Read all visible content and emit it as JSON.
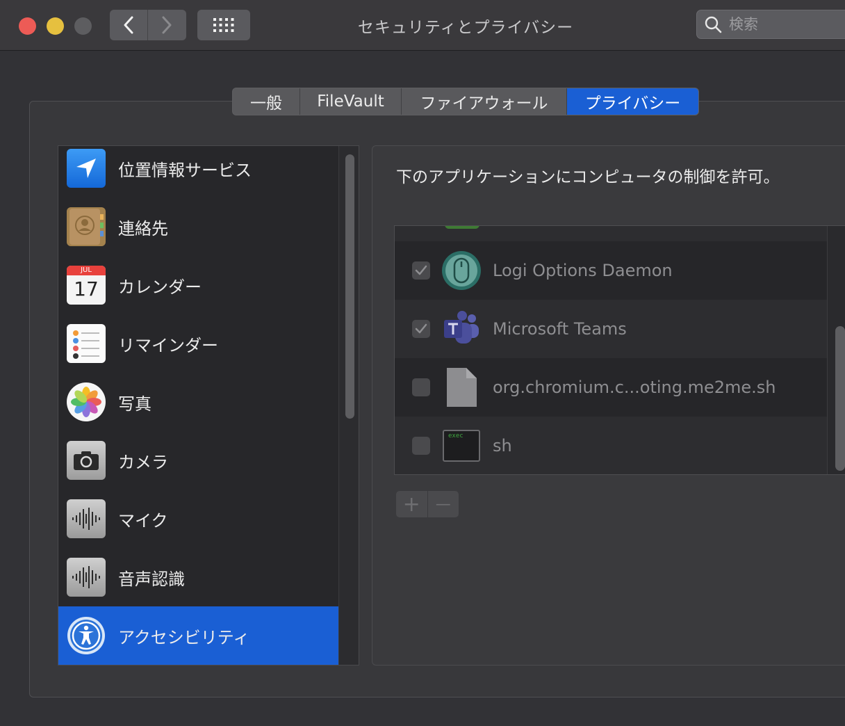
{
  "window": {
    "title": "セキュリティとプライバシー"
  },
  "search": {
    "placeholder": "検索"
  },
  "tabs": [
    {
      "label": "一般",
      "active": false
    },
    {
      "label": "FileVault",
      "active": false
    },
    {
      "label": "ファイアウォール",
      "active": false
    },
    {
      "label": "プライバシー",
      "active": true
    }
  ],
  "sidebar": {
    "items": [
      {
        "label": "位置情報サービス",
        "icon": "location-arrow-icon"
      },
      {
        "label": "連絡先",
        "icon": "contacts-book-icon"
      },
      {
        "label": "カレンダー",
        "icon": "calendar-icon",
        "calendar_month": "JUL",
        "calendar_day": "17"
      },
      {
        "label": "リマインダー",
        "icon": "reminders-list-icon"
      },
      {
        "label": "写真",
        "icon": "photos-flower-icon"
      },
      {
        "label": "カメラ",
        "icon": "camera-icon"
      },
      {
        "label": "マイク",
        "icon": "microphone-waveform-icon"
      },
      {
        "label": "音声認識",
        "icon": "speech-waveform-icon"
      },
      {
        "label": "アクセシビリティ",
        "icon": "accessibility-icon",
        "active": true
      }
    ]
  },
  "main": {
    "description": "下のアプリケーションにコンピュータの制御を許可。",
    "apps": [
      {
        "name": "Logi Options Daemon",
        "checked": true,
        "icon": "logi-mouse-icon"
      },
      {
        "name": "Microsoft Teams",
        "checked": true,
        "icon": "teams-icon"
      },
      {
        "name": "org.chromium.c...oting.me2me.sh",
        "checked": false,
        "icon": "document-icon"
      },
      {
        "name": "sh",
        "checked": false,
        "icon": "terminal-exec-icon",
        "icon_text": "exec"
      }
    ],
    "add_label": "+",
    "remove_label": "—"
  },
  "colors": {
    "accent": "#1a5fd4",
    "close": "#ed5b56",
    "minimize": "#e6c03f"
  }
}
